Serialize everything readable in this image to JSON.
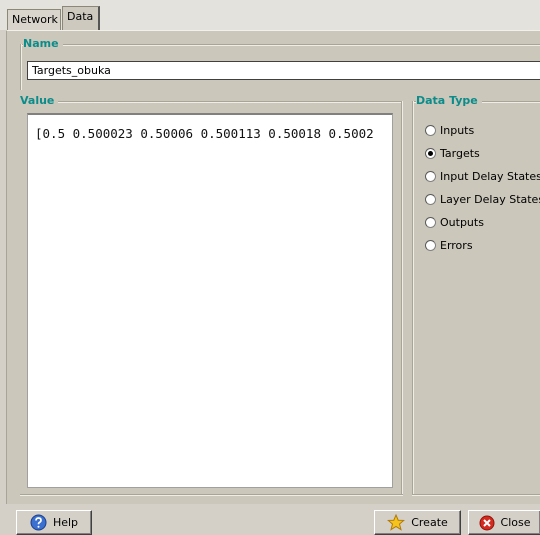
{
  "tabs": [
    "Network",
    "Data"
  ],
  "active_tab": "Data",
  "name_section": {
    "legend": "Name",
    "value": "Targets_obuka"
  },
  "value_section": {
    "legend": "Value",
    "text": "[0.5 0.500023 0.50006 0.500113 0.50018 0.5002"
  },
  "data_type": {
    "legend": "Data Type",
    "options": [
      "Inputs",
      "Targets",
      "Input Delay States",
      "Layer Delay States",
      "Outputs",
      "Errors"
    ],
    "selected": "Targets"
  },
  "buttons": {
    "help": "Help",
    "create": "Create",
    "close": "Close"
  },
  "colors": {
    "legend_text": "#0b8c8a",
    "panel_bg": "#cbc7bb",
    "window_bg": "#d4d0c8"
  },
  "icons": {
    "help": "help-icon",
    "create": "star-icon",
    "close": "close-icon"
  }
}
